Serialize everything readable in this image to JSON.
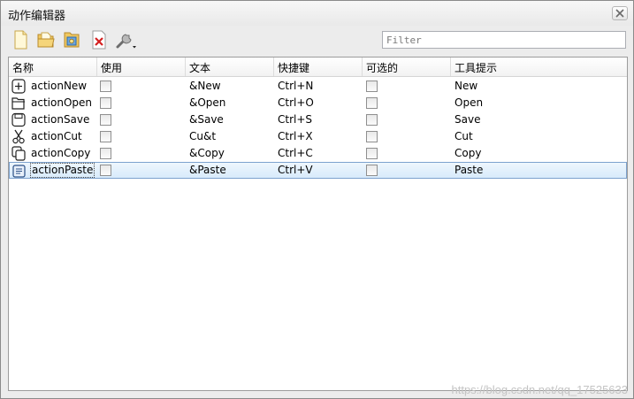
{
  "window": {
    "title": "动作编辑器"
  },
  "toolbar": {
    "buttons": [
      {
        "icon": "new-document-icon"
      },
      {
        "icon": "open-folder-icon"
      },
      {
        "icon": "edit-action-icon"
      },
      {
        "icon": "delete-icon"
      },
      {
        "icon": "configure-wrench-icon"
      }
    ],
    "filter_placeholder": "Filter"
  },
  "table": {
    "columns": [
      "名称",
      "使用",
      "文本",
      "快捷键",
      "可选的",
      "工具提示"
    ],
    "rows": [
      {
        "name": "actionNew",
        "icon": "new-icon",
        "text": "&New",
        "shortcut": "Ctrl+N",
        "tooltip": "New",
        "used": false,
        "checkable": false,
        "selected": false
      },
      {
        "name": "actionOpen",
        "icon": "open-icon",
        "text": "&Open",
        "shortcut": "Ctrl+O",
        "tooltip": "Open",
        "used": false,
        "checkable": false,
        "selected": false
      },
      {
        "name": "actionSave",
        "icon": "save-icon",
        "text": "&Save",
        "shortcut": "Ctrl+S",
        "tooltip": "Save",
        "used": false,
        "checkable": false,
        "selected": false
      },
      {
        "name": "actionCut",
        "icon": "cut-icon",
        "text": "Cu&t",
        "shortcut": "Ctrl+X",
        "tooltip": "Cut",
        "used": false,
        "checkable": false,
        "selected": false
      },
      {
        "name": "actionCopy",
        "icon": "copy-icon",
        "text": "&Copy",
        "shortcut": "Ctrl+C",
        "tooltip": "Copy",
        "used": false,
        "checkable": false,
        "selected": false
      },
      {
        "name": "actionPaste",
        "icon": "paste-icon",
        "text": "&Paste",
        "shortcut": "Ctrl+V",
        "tooltip": "Paste",
        "used": false,
        "checkable": false,
        "selected": true
      }
    ]
  },
  "watermark": "https://blog.csdn.net/qq_17525633"
}
